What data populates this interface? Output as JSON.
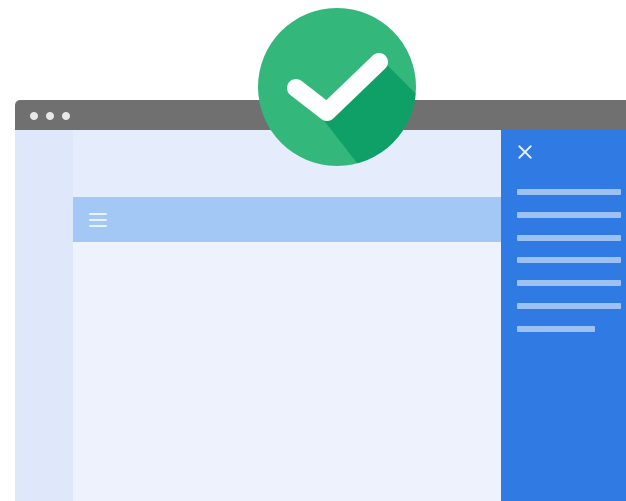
{
  "illustration": {
    "type": "browser-window-with-open-side-drawer",
    "window_controls": [
      "dot",
      "dot",
      "dot"
    ],
    "appbar_icon": "hamburger-menu-icon",
    "drawer_close_icon": "close-icon",
    "drawer_item_count": 7,
    "badge_icon": "checkmark-icon",
    "status": "success"
  },
  "colors": {
    "titlebar": "#707070",
    "viewport": "#e5edfd",
    "page": "#edf2fd",
    "appbar": "#a4c8f6",
    "drawer": "#2f7ae3",
    "drawer_items": "#9cc1f2",
    "badge": "#33b77a",
    "badge_shadow": "#0ea066",
    "check": "#ffffff"
  }
}
